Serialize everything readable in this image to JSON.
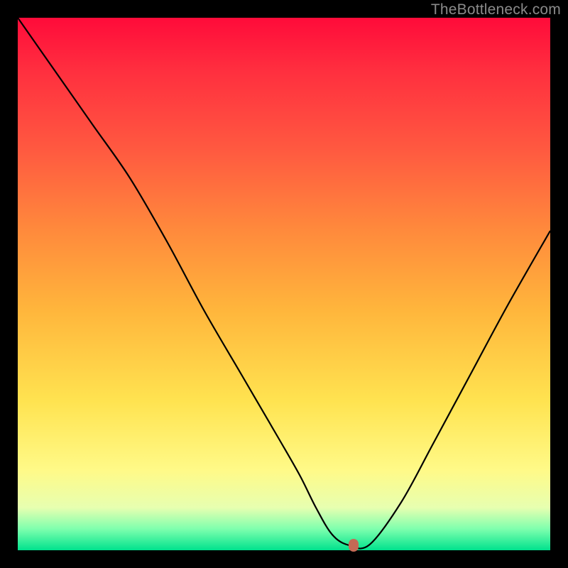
{
  "watermark": "TheBottleneck.com",
  "chart_data": {
    "type": "line",
    "title": "",
    "xlabel": "",
    "ylabel": "",
    "xlim": [
      0,
      100
    ],
    "ylim": [
      0,
      100
    ],
    "grid": false,
    "legend": false,
    "series": [
      {
        "name": "curve",
        "x": [
          0,
          7,
          14,
          21,
          28,
          35,
          42,
          49,
          53,
          56,
          59,
          62,
          66,
          72,
          78,
          85,
          92,
          100
        ],
        "y": [
          100,
          90,
          80,
          70,
          58,
          45,
          33,
          21,
          14,
          8,
          3,
          1,
          1,
          9,
          20,
          33,
          46,
          60
        ]
      }
    ],
    "marker": {
      "x": 63,
      "y": 1
    },
    "gradient_stops": [
      {
        "pos": 0,
        "color": "#ff0b3a"
      },
      {
        "pos": 10,
        "color": "#ff2f3f"
      },
      {
        "pos": 25,
        "color": "#ff5a40"
      },
      {
        "pos": 40,
        "color": "#ff8a3c"
      },
      {
        "pos": 55,
        "color": "#ffb63c"
      },
      {
        "pos": 72,
        "color": "#ffe350"
      },
      {
        "pos": 85,
        "color": "#fffa88"
      },
      {
        "pos": 92,
        "color": "#e7ffb0"
      },
      {
        "pos": 96,
        "color": "#7effae"
      },
      {
        "pos": 100,
        "color": "#00e28d"
      }
    ]
  }
}
